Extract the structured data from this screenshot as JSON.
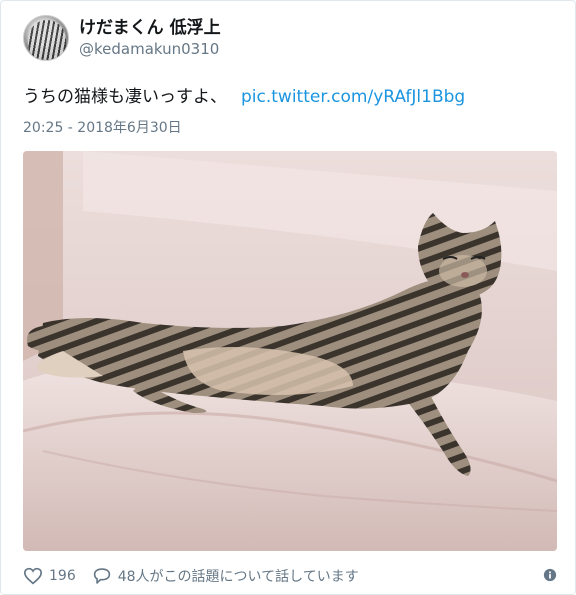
{
  "user": {
    "display_name": "けだまくん 低浮上",
    "handle": "@kedamakun0310",
    "avatar_icon": "avatar-image"
  },
  "tweet": {
    "text": "うちの猫様も凄いっすよ、",
    "link": "pic.twitter.com/yRAfJl1Bbg",
    "timestamp": "20:25 - 2018年6月30日",
    "photo_icon": "cat-photo"
  },
  "footer": {
    "like_count": "196",
    "reply_text": "48人がこの話題について話しています",
    "heart_icon": "heart-icon",
    "reply_icon": "speech-bubble-icon",
    "info_icon": "info-icon"
  },
  "colors": {
    "link": "#1b95e0",
    "secondary": "#657786",
    "primary_text": "#14171a"
  }
}
